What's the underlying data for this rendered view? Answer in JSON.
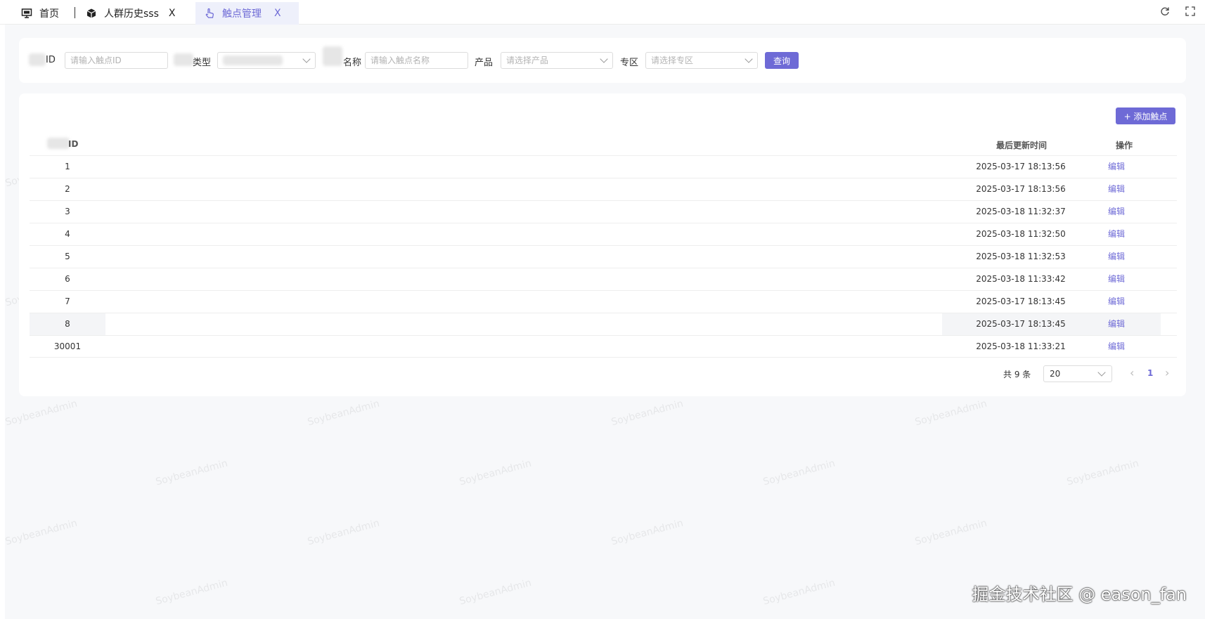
{
  "tabs": [
    {
      "label": "首页",
      "icon": "monitor-icon"
    },
    {
      "label": "人群历史sss",
      "icon": "cube-icon",
      "close": "X"
    },
    {
      "label": "触点管理",
      "icon": "hand-pointer-icon",
      "close": "X",
      "active": true
    }
  ],
  "toolbar_icons": [
    "refresh-icon",
    "fullscreen-icon"
  ],
  "filters": {
    "id_label": "ID",
    "id_placeholder": "请输入触点ID",
    "type_label": "类型",
    "name_label": "名称",
    "name_placeholder": "请输入触点名称",
    "product_label": "产品",
    "product_placeholder": "请选择产品",
    "zone_label": "专区",
    "zone_placeholder": "请选择专区",
    "query_button": "查询"
  },
  "add_button": "+ 添加触点",
  "table": {
    "headers": {
      "id": "ID",
      "updated": "最后更新时间",
      "actions": "操作"
    },
    "rows": [
      {
        "id": "1",
        "updated": "2025-03-17 18:13:56",
        "action": "编辑"
      },
      {
        "id": "2",
        "updated": "2025-03-17 18:13:56",
        "action": "编辑"
      },
      {
        "id": "3",
        "updated": "2025-03-18 11:32:37",
        "action": "编辑"
      },
      {
        "id": "4",
        "updated": "2025-03-18 11:32:50",
        "action": "编辑"
      },
      {
        "id": "5",
        "updated": "2025-03-18 11:32:53",
        "action": "编辑"
      },
      {
        "id": "6",
        "updated": "2025-03-18 11:33:42",
        "action": "编辑"
      },
      {
        "id": "7",
        "updated": "2025-03-17 18:13:45",
        "action": "编辑"
      },
      {
        "id": "8",
        "updated": "2025-03-17 18:13:45",
        "action": "编辑"
      },
      {
        "id": "30001",
        "updated": "2025-03-18 11:33:21",
        "action": "编辑"
      }
    ]
  },
  "pagination": {
    "total": "共 9 条",
    "page_size": "20",
    "current_page": "1",
    "prev": "‹",
    "next": "›"
  },
  "watermark": "SoybeanAdmin",
  "credit": "掘金技术社区 @ eason_fan",
  "colors": {
    "accent": "#6e6ad6",
    "background": "#f7f8fa"
  }
}
